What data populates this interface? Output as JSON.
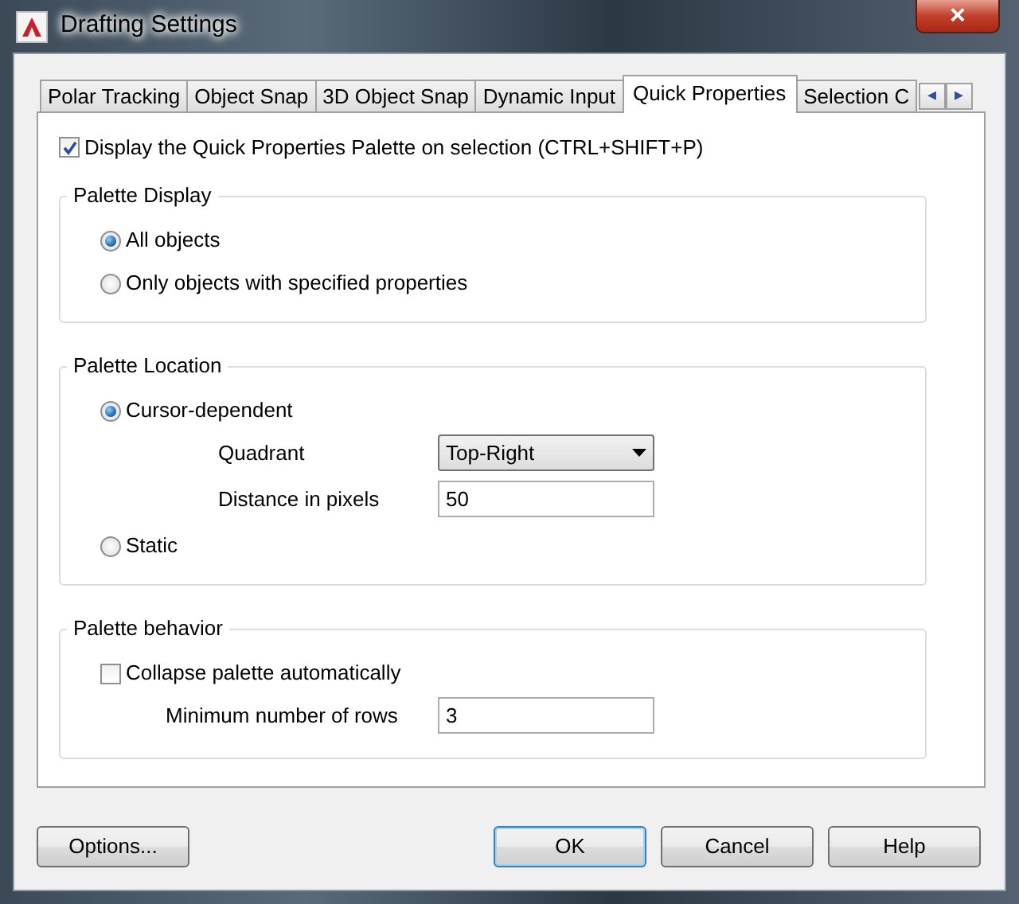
{
  "window": {
    "title": "Drafting Settings",
    "close_label": "×"
  },
  "tabs": [
    {
      "label": "Polar Tracking",
      "selected": false
    },
    {
      "label": "Object Snap",
      "selected": false
    },
    {
      "label": "3D Object Snap",
      "selected": false
    },
    {
      "label": "Dynamic Input",
      "selected": false
    },
    {
      "label": "Quick Properties",
      "selected": true
    },
    {
      "label": "Selection C",
      "selected": false
    }
  ],
  "tab_scroll": [
    "◂",
    "▸"
  ],
  "display_palette": {
    "label": "Display the Quick Properties Palette on selection (CTRL+SHIFT+P)",
    "checked": true
  },
  "groups": [
    {
      "title": "Palette Display",
      "items": [
        {
          "kind": "radio",
          "label": "All objects",
          "selected": true
        },
        {
          "kind": "radio",
          "label": "Only objects with specified properties",
          "selected": false
        }
      ]
    },
    {
      "title": "Palette Location",
      "items": [
        {
          "kind": "radio",
          "label": "Cursor-dependent",
          "selected": true,
          "children": [
            {
              "kind": "dropdown",
              "label": "Quadrant",
              "value": "Top-Right"
            },
            {
              "kind": "textbox",
              "label": "Distance in pixels",
              "value": "50"
            }
          ]
        },
        {
          "kind": "radio",
          "label": "Static",
          "selected": false
        }
      ]
    },
    {
      "title": "Palette behavior",
      "items": [
        {
          "kind": "checkbox",
          "label": "Collapse palette automatically",
          "checked": false,
          "children": [
            {
              "kind": "textbox",
              "label": "Minimum number of rows",
              "value": "3"
            }
          ]
        }
      ]
    }
  ],
  "buttons": [
    {
      "label": "Options...",
      "default": false
    },
    {
      "label": "OK",
      "default": true
    },
    {
      "label": "Cancel",
      "default": false
    },
    {
      "label": "Help",
      "default": false
    }
  ]
}
